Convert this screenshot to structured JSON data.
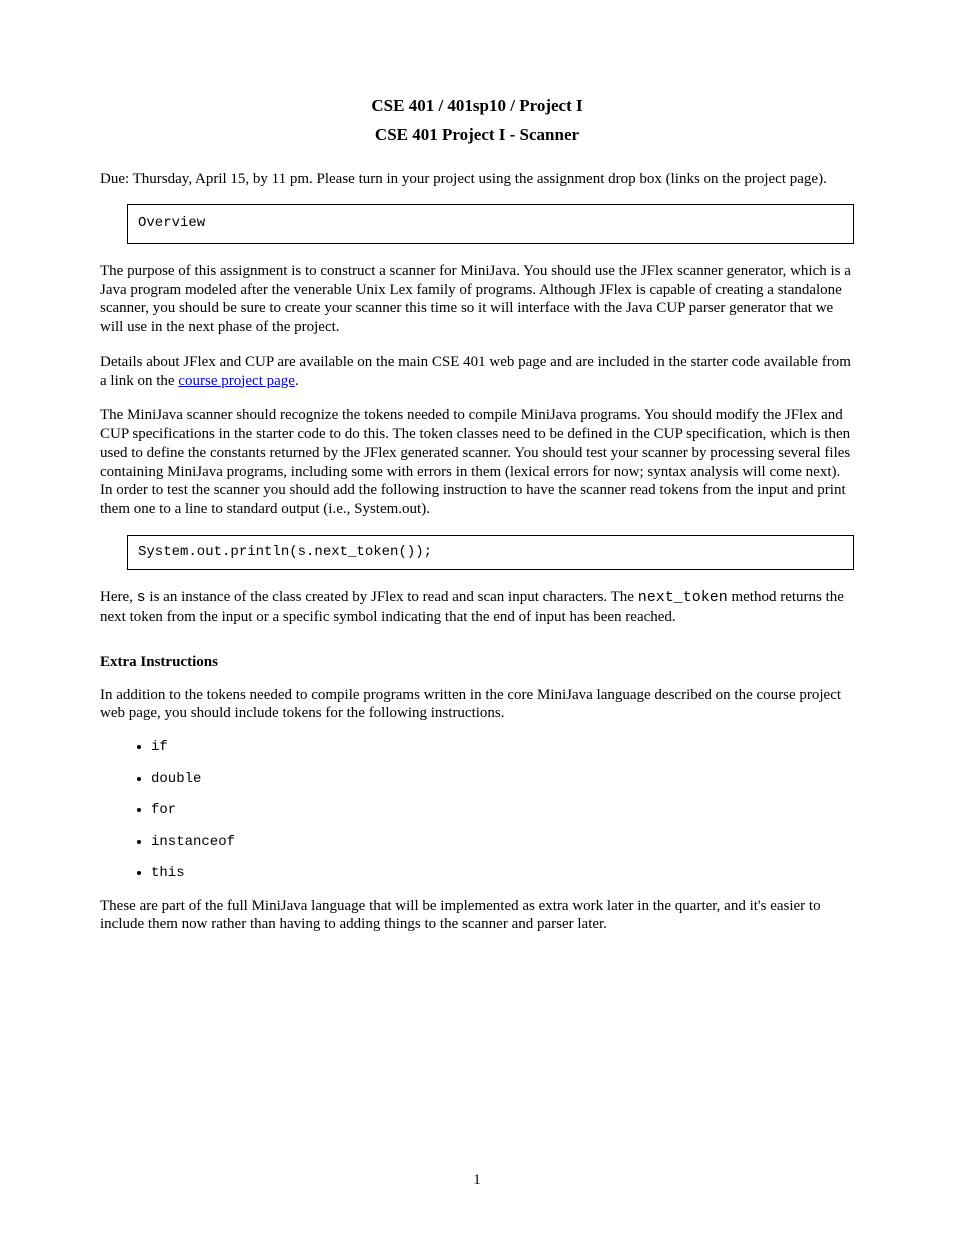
{
  "title": "CSE 401 / 401sp10 / Project I",
  "subtitle": "CSE 401 Project I - Scanner",
  "due_line": "Due: Thursday, April 15, by 11 pm. Please turn in your project using the assignment drop box (links on the project page).",
  "overview_head": "Overview",
  "overview_p1": "The purpose of this assignment is to construct a scanner for MiniJava. You should use the JFlex scanner generator, which is a Java program modeled after the venerable Unix Lex family of programs. Although JFlex is capable of creating a standalone scanner, you should be sure to create your scanner this time so it will interface with the Java CUP parser generator that we will use in the next phase of the project.",
  "overview_p2_before_link": "Details about JFlex and CUP are available on the main CSE 401 web page and are included in the starter code available from a link on the ",
  "overview_link_text": "course project page",
  "overview_p2_after_link": ".",
  "scanner_p1": "The MiniJava scanner should recognize the tokens needed to compile MiniJava programs. You should modify the JFlex and CUP specifications in the starter code to do this. The token classes need to be defined in the CUP specification, which is then used to define the constants returned by the JFlex generated scanner. You should test your scanner by processing several files containing MiniJava programs, including some with errors in them (lexical errors for now; syntax analysis will come next). In order to test the scanner you should add the following instruction to have the scanner read tokens from the input and print them one to a line to standard output (i.e., System.out).",
  "codebox2": "System.out.println(s.next_token());",
  "scanner_p2_before_code": "Here, ",
  "scanner_p2_code1": "s",
  "scanner_p2_mid": " is an instance of the class created by JFlex to read and scan input characters. The ",
  "scanner_p2_code2": "next_token",
  "scanner_p2_after_code": " method returns the next token from the input or a specific symbol indicating that the end of input has been reached.",
  "extra_head": "Extra Instructions",
  "extra_p1": "In addition to the tokens needed to compile programs written in the core MiniJava language described on the course project web page, you should include tokens for the following instructions.",
  "inst": [
    "if",
    "double",
    "for",
    "instanceof",
    "this"
  ],
  "extra_p2": "These are part of the full MiniJava language that will be implemented as extra work later in the quarter, and it's easier to include them now rather than having to adding things to the scanner and parser later.",
  "page_number": "1"
}
